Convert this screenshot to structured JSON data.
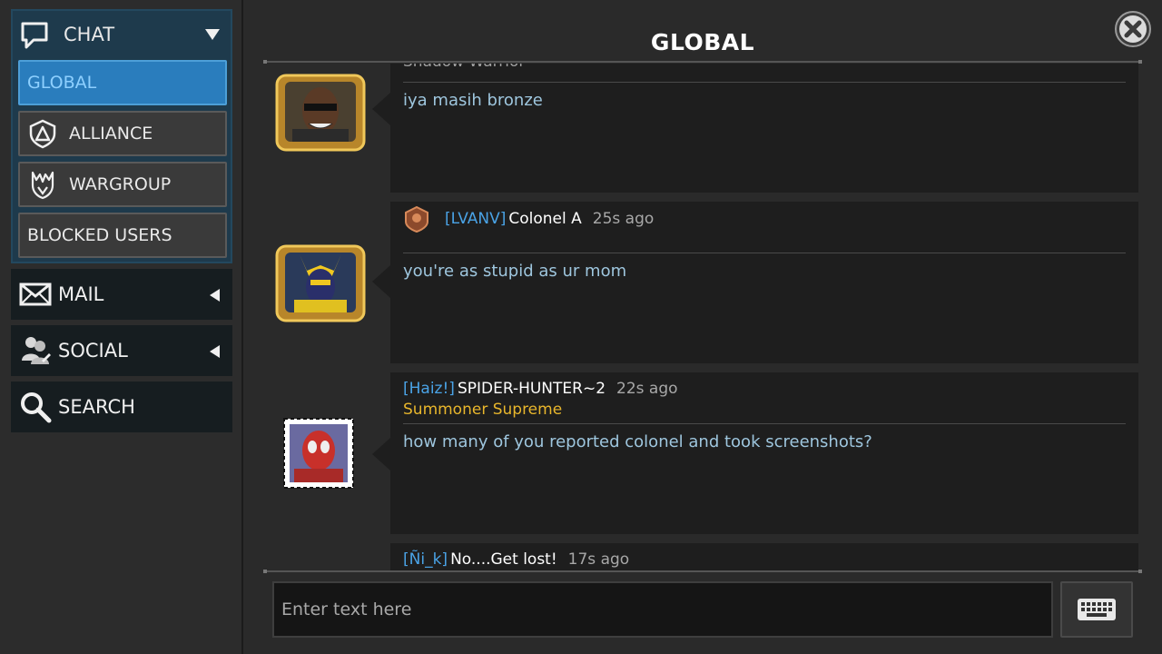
{
  "sidebar": {
    "chat": {
      "label": "CHAT",
      "icon": "speech-bubble-icon"
    },
    "chat_items": [
      {
        "label": "GLOBAL",
        "active": true
      },
      {
        "label": "ALLIANCE",
        "icon": "alliance-shield-icon"
      },
      {
        "label": "WARGROUP",
        "icon": "wargroup-icon"
      },
      {
        "label": "BLOCKED USERS"
      }
    ],
    "nav": [
      {
        "label": "MAIL",
        "icon": "envelope-icon"
      },
      {
        "label": "SOCIAL",
        "icon": "social-people-icon"
      },
      {
        "label": "SEARCH",
        "icon": "magnifier-icon"
      }
    ]
  },
  "header": {
    "title": "GLOBAL",
    "close_icon": "close-icon"
  },
  "messages": [
    {
      "subtitle": "Shadow Warrior",
      "text": "iya masih bronze",
      "avatar": "blade-portrait-gold-frame"
    },
    {
      "tag": "[LVANV]",
      "name": "Colonel A",
      "time": "25s ago",
      "text": "you're as stupid as ur mom",
      "avatar": "wolverine-x23-portrait-gold-frame",
      "badge": "rank-badge-icon"
    },
    {
      "tag": "[Haiz!]",
      "name": "SPIDER-HUNTER~2",
      "time": "22s ago",
      "subtitle": "Summoner Supreme",
      "text": "how many of you reported colonel  and took screenshots?",
      "avatar": "spiderman-portrait-stamp-frame"
    },
    {
      "tag": "[Ñi_k]",
      "name": "No....Get lost!",
      "time": "17s ago"
    }
  ],
  "composer": {
    "placeholder": "Enter text here",
    "keyboard_icon": "keyboard-icon"
  },
  "colors": {
    "accent": "#2a7dbd",
    "tag": "#4aa3e6",
    "title_gold": "#e8b62c",
    "message_text": "#9ec6de"
  }
}
